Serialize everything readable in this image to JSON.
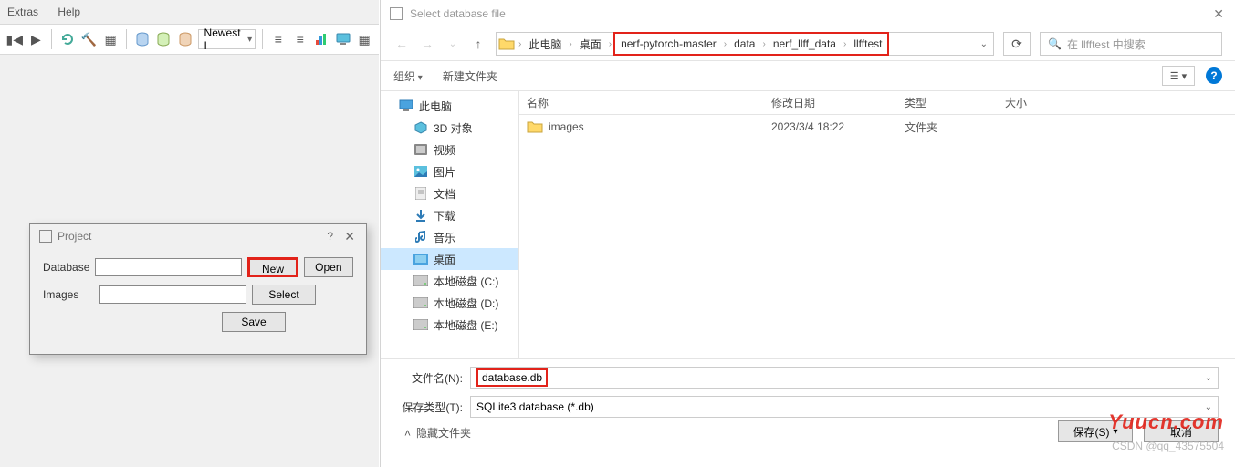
{
  "left_app": {
    "menu": [
      "Extras",
      "Help"
    ],
    "filter_label": "Newest I"
  },
  "project_dialog": {
    "title": "Project",
    "database_label": "Database",
    "images_label": "Images",
    "database_value": "",
    "images_value": "",
    "new_btn": "New",
    "open_btn": "Open",
    "select_btn": "Select",
    "save_btn": "Save"
  },
  "file_dialog": {
    "title": "Select database file",
    "breadcrumbs": [
      "此电脑",
      "桌面",
      "nerf-pytorch-master",
      "data",
      "nerf_llff_data",
      "llfftest"
    ],
    "search_placeholder": "在 llfftest 中搜索",
    "organize": "组织",
    "new_folder": "新建文件夹",
    "columns": {
      "name": "名称",
      "date": "修改日期",
      "type": "类型",
      "size": "大小"
    },
    "rows": [
      {
        "name": "images",
        "date": "2023/3/4 18:22",
        "type": "文件夹",
        "size": ""
      }
    ],
    "sidebar": [
      {
        "label": "此电脑",
        "icon": "pc",
        "head": true
      },
      {
        "label": "3D 对象",
        "icon": "3d"
      },
      {
        "label": "视频",
        "icon": "video"
      },
      {
        "label": "图片",
        "icon": "pic"
      },
      {
        "label": "文档",
        "icon": "doc"
      },
      {
        "label": "下载",
        "icon": "dl"
      },
      {
        "label": "音乐",
        "icon": "music"
      },
      {
        "label": "桌面",
        "icon": "desk",
        "selected": true
      },
      {
        "label": "本地磁盘 (C:)",
        "icon": "disk"
      },
      {
        "label": "本地磁盘 (D:)",
        "icon": "disk"
      },
      {
        "label": "本地磁盘 (E:)",
        "icon": "disk"
      }
    ],
    "filename_label": "文件名(N):",
    "filename_value": "database.db",
    "filetype_label": "保存类型(T):",
    "filetype_value": "SQLite3 database (*.db)",
    "hide_folders": "隐藏文件夹",
    "save_btn": "保存(S)",
    "cancel_btn": "取消"
  },
  "watermark": "Yuucn.com",
  "watermark2": "CSDN @qq_43575504"
}
